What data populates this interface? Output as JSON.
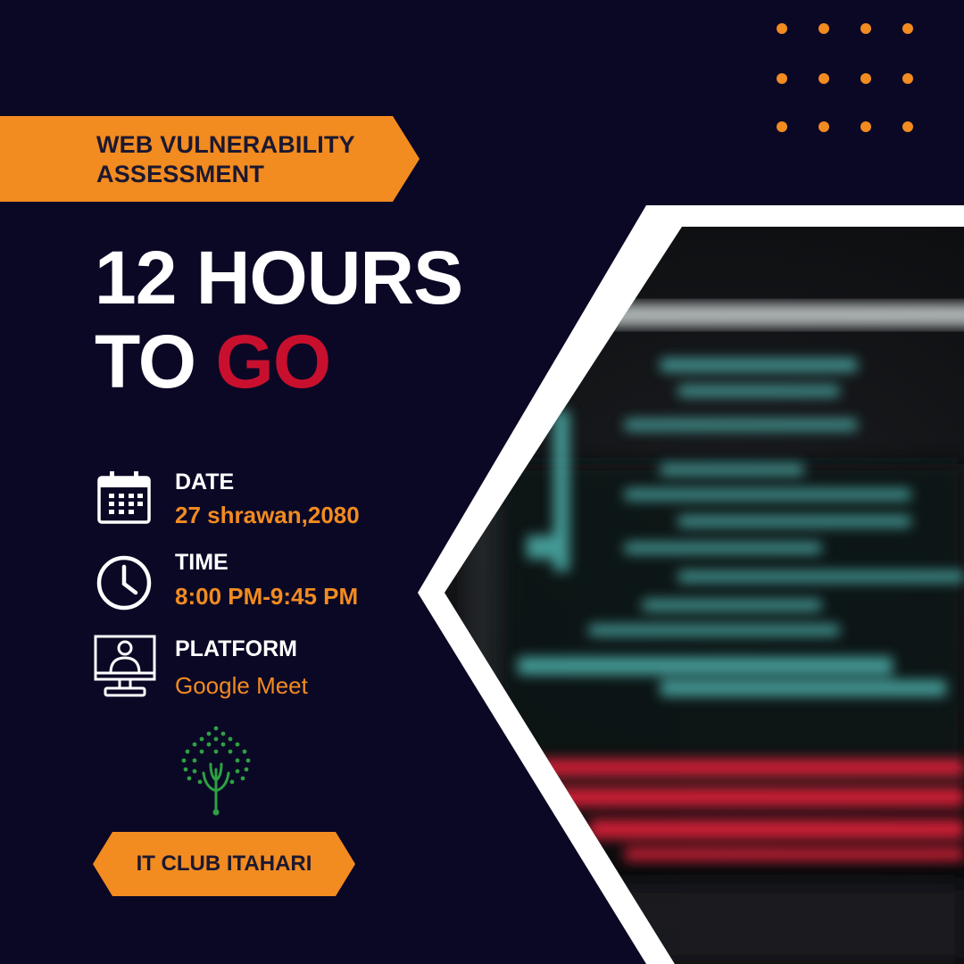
{
  "banner": {
    "line1": "WEB VULNERABILITY",
    "line2": "ASSESSMENT"
  },
  "headline": {
    "line1": "12 HOURS",
    "line2_white": "TO",
    "line2_red": "GO"
  },
  "details": [
    {
      "label": "DATE",
      "value": "27 shrawan,2080",
      "icon": "calendar-icon"
    },
    {
      "label": "TIME",
      "value": "8:00 PM-9:45 PM",
      "icon": "clock-icon"
    },
    {
      "label": "PLATFORM",
      "value": "Google Meet",
      "icon": "computer-user-icon"
    }
  ],
  "footer": {
    "label": "IT CLUB ITAHARI"
  },
  "logo": {
    "icon": "tree-circuit-logo"
  },
  "photo": {
    "subject": "blurred laptop screen with code"
  },
  "colors": {
    "background": "#0b0826",
    "accent": "#f28b20",
    "highlight": "#c8102e",
    "text": "#ffffff"
  }
}
